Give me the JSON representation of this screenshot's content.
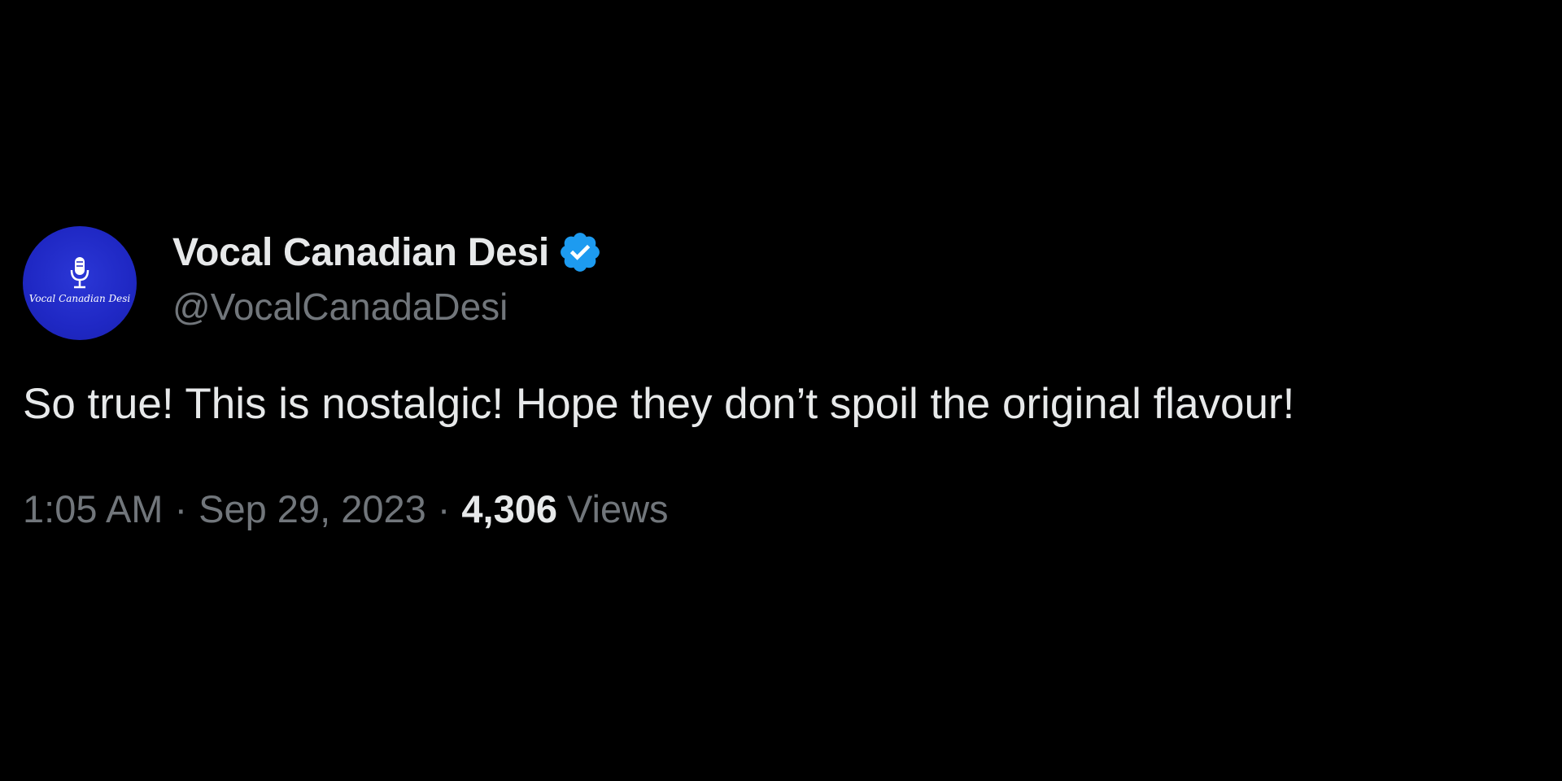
{
  "tweet": {
    "author": {
      "display_name": "Vocal Canadian Desi",
      "handle": "@VocalCanadaDesi",
      "verified": true,
      "avatar_text": "Vocal Canadian Desi",
      "avatar_icon": "microphone-icon"
    },
    "text": "So true! This is nostalgic! Hope they don’t spoil the original flavour!",
    "time": "1:05 AM",
    "separator": "·",
    "date": "Sep 29, 2023",
    "views_count": "4,306",
    "views_label": "Views"
  },
  "colors": {
    "background": "#000000",
    "primary_text": "#e7e9ea",
    "secondary_text": "#71767b",
    "verified_badge": "#1d9bf0",
    "avatar_bg": "#1f28c4"
  }
}
